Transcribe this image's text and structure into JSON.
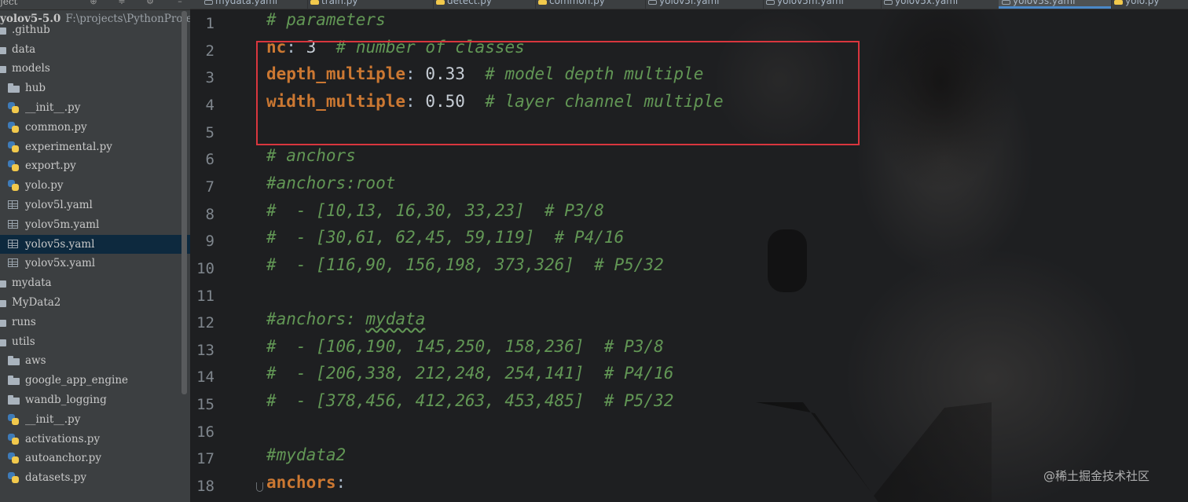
{
  "project": {
    "header_label": "ject",
    "root_name": "yolov5-5.0",
    "root_path": "F:\\projects\\PythonProje",
    "items": [
      {
        "label": ".github",
        "icon": "folder-icon"
      },
      {
        "label": "data",
        "icon": "folder-icon"
      },
      {
        "label": "models",
        "icon": "folder-icon"
      },
      {
        "label": "hub",
        "icon": "folder-icon"
      },
      {
        "label": "__init__.py",
        "icon": "python-file-icon"
      },
      {
        "label": "common.py",
        "icon": "python-file-icon"
      },
      {
        "label": "experimental.py",
        "icon": "python-file-icon"
      },
      {
        "label": "export.py",
        "icon": "python-file-icon"
      },
      {
        "label": "yolo.py",
        "icon": "python-file-icon"
      },
      {
        "label": "yolov5l.yaml",
        "icon": "yaml-file-icon"
      },
      {
        "label": "yolov5m.yaml",
        "icon": "yaml-file-icon"
      },
      {
        "label": "yolov5s.yaml",
        "icon": "yaml-file-icon",
        "selected": true
      },
      {
        "label": "yolov5x.yaml",
        "icon": "yaml-file-icon"
      },
      {
        "label": "mydata",
        "icon": "folder-icon"
      },
      {
        "label": "MyData2",
        "icon": "folder-icon"
      },
      {
        "label": "runs",
        "icon": "folder-icon"
      },
      {
        "label": "utils",
        "icon": "folder-icon"
      },
      {
        "label": "aws",
        "icon": "folder-icon"
      },
      {
        "label": "google_app_engine",
        "icon": "folder-icon"
      },
      {
        "label": "wandb_logging",
        "icon": "folder-icon"
      },
      {
        "label": "__init__.py",
        "icon": "python-file-icon"
      },
      {
        "label": "activations.py",
        "icon": "python-file-icon"
      },
      {
        "label": "autoanchor.py",
        "icon": "python-file-icon"
      },
      {
        "label": "datasets.py",
        "icon": "python-file-icon"
      }
    ]
  },
  "tabs": [
    {
      "label": "mydata.yaml",
      "kind": "yaml"
    },
    {
      "label": "train.py",
      "kind": "python"
    },
    {
      "label": "detect.py",
      "kind": "python"
    },
    {
      "label": "common.py",
      "kind": "python"
    },
    {
      "label": "yolov5l.yaml",
      "kind": "yaml"
    },
    {
      "label": "yolov5m.yaml",
      "kind": "yaml"
    },
    {
      "label": "yolov5x.yaml",
      "kind": "yaml"
    },
    {
      "label": "yolov5s.yaml",
      "kind": "yaml",
      "active": true
    },
    {
      "label": "yolo.py",
      "kind": "python"
    }
  ],
  "editor": {
    "line_numbers": [
      "1",
      "2",
      "3",
      "4",
      "5",
      "6",
      "7",
      "8",
      "9",
      "10",
      "11",
      "12",
      "13",
      "14",
      "15",
      "16",
      "17",
      "18"
    ],
    "lines": [
      {
        "segs": [
          {
            "t": "# parameters",
            "c": "cmt"
          }
        ]
      },
      {
        "segs": [
          {
            "t": "nc",
            "c": "key"
          },
          {
            "t": ": ",
            "c": "punct"
          },
          {
            "t": "3",
            "c": "num"
          },
          {
            "t": "  ",
            "c": "punct"
          },
          {
            "t": "# number of classes",
            "c": "cmt"
          }
        ]
      },
      {
        "segs": [
          {
            "t": "depth_multiple",
            "c": "key"
          },
          {
            "t": ": ",
            "c": "punct"
          },
          {
            "t": "0.33",
            "c": "num"
          },
          {
            "t": "  ",
            "c": "punct"
          },
          {
            "t": "# model depth multiple",
            "c": "cmt"
          }
        ]
      },
      {
        "segs": [
          {
            "t": "width_multiple",
            "c": "key"
          },
          {
            "t": ": ",
            "c": "punct"
          },
          {
            "t": "0.50",
            "c": "num"
          },
          {
            "t": "  ",
            "c": "punct"
          },
          {
            "t": "# layer channel multiple",
            "c": "cmt"
          }
        ]
      },
      {
        "segs": []
      },
      {
        "segs": [
          {
            "t": "# anchors",
            "c": "cmt"
          }
        ]
      },
      {
        "segs": [
          {
            "t": "#anchors:root",
            "c": "cmt"
          }
        ]
      },
      {
        "segs": [
          {
            "t": "#  - [10,13, 16,30, 33,23]  # P3/8",
            "c": "cmt"
          }
        ]
      },
      {
        "segs": [
          {
            "t": "#  - [30,61, 62,45, 59,119]  # P4/16",
            "c": "cmt"
          }
        ]
      },
      {
        "segs": [
          {
            "t": "#  - [116,90, 156,198, 373,326]  # P5/32",
            "c": "cmt"
          }
        ]
      },
      {
        "segs": []
      },
      {
        "segs": [
          {
            "t": "#anchors: ",
            "c": "cmt"
          },
          {
            "t": "mydata",
            "c": "cmt sq"
          }
        ]
      },
      {
        "segs": [
          {
            "t": "#  - [106,190, 145,250, 158,236]  # P3/8",
            "c": "cmt"
          }
        ]
      },
      {
        "segs": [
          {
            "t": "#  - [206,338, 212,248, 254,141]  # P4/16",
            "c": "cmt"
          }
        ]
      },
      {
        "segs": [
          {
            "t": "#  - [378,456, 412,263, 453,485]  # P5/32",
            "c": "cmt"
          }
        ]
      },
      {
        "segs": []
      },
      {
        "segs": [
          {
            "t": "#mydata2",
            "c": "cmt"
          }
        ]
      },
      {
        "segs": [
          {
            "t": "anchors",
            "c": "key"
          },
          {
            "t": ":",
            "c": "punct"
          }
        ]
      }
    ]
  },
  "watermark": "@稀土掘金技术社区",
  "colors": {
    "editor_bg": "#1e1f21",
    "keyword": "#cc7832",
    "comment": "#629755",
    "highlight_box": "#d9363e",
    "selection": "#0d293e"
  }
}
